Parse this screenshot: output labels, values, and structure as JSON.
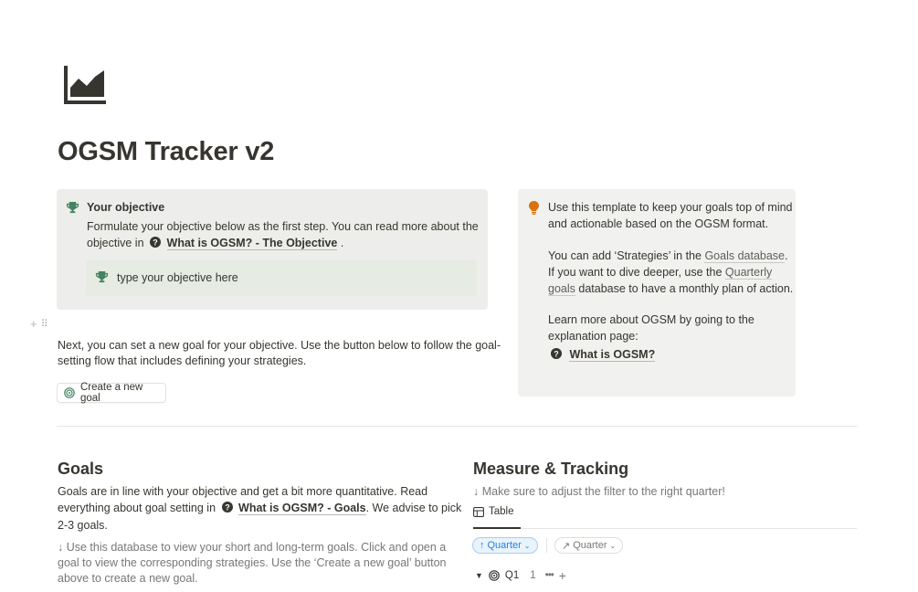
{
  "page": {
    "title": "OGSM Tracker v2",
    "icon": "chart-area-icon"
  },
  "objective_callout": {
    "icon": "trophy-icon",
    "heading": "Your objective",
    "text_line1": "Formulate your objective below as the first step. You can read more about the",
    "text_line2_prefix": "objective in",
    "link_label": "What is OGSM? - The Objective",
    "text_line2_suffix": ".",
    "inner_placeholder": "type your objective here",
    "color": "#edeeeb"
  },
  "info_callout": {
    "icon": "lightbulb-icon",
    "p1_line1": "Use this template to keep your goals top of mind",
    "p1_line2": "and actionable based on the OGSM format.",
    "p2_line1_prefix": "You can add ‘Strategies’ in the",
    "p2_link1": "Goals database",
    "p2_line1_suffix": ".",
    "p2_line2_prefix": "If you want to dive deeper, use the",
    "p2_link2_part1": "Quarterly",
    "p2_link2_part2": "goals",
    "p2_line3_suffix": "database to have a monthly plan of action.",
    "p3_line1": "Learn more about OGSM by going to the",
    "p3_line2": "explanation page:",
    "p3_link": "What is OGSM?"
  },
  "intro": {
    "line1": "Next, you can set a new goal for your objective. Use the button below to follow the goal-",
    "line2": "setting flow that includes defining your strategies.",
    "button_label": "Create a new goal"
  },
  "goals": {
    "heading": "Goals",
    "line1": "Goals are in line with your objective and get a bit more quantitative. Read",
    "line2_prefix": "everything about goal setting in",
    "line2_link": "What is OGSM? - Goals",
    "line2_suffix": ". We advise to pick",
    "line3": "2-3 goals.",
    "note_line1": "↓ Use this database to view your short and long-term goals. Click and open a",
    "note_line2": "goal to view the corresponding strategies. Use the ‘Create a new goal’ button",
    "note_line3": "above to create a new goal."
  },
  "measure": {
    "heading": "Measure & Tracking",
    "note": "↓ Make sure to adjust the filter to the right quarter!",
    "tab_label": "Table",
    "sort_chip": "Quarter",
    "filter_chip": "Quarter",
    "group": {
      "label": "Q1",
      "count": "1"
    }
  },
  "colors": {
    "accent_blue": "#2383e2",
    "text": "#37352f",
    "muted": "#787774",
    "trophy_green": "#448361",
    "bulb_orange": "#d9730d"
  }
}
